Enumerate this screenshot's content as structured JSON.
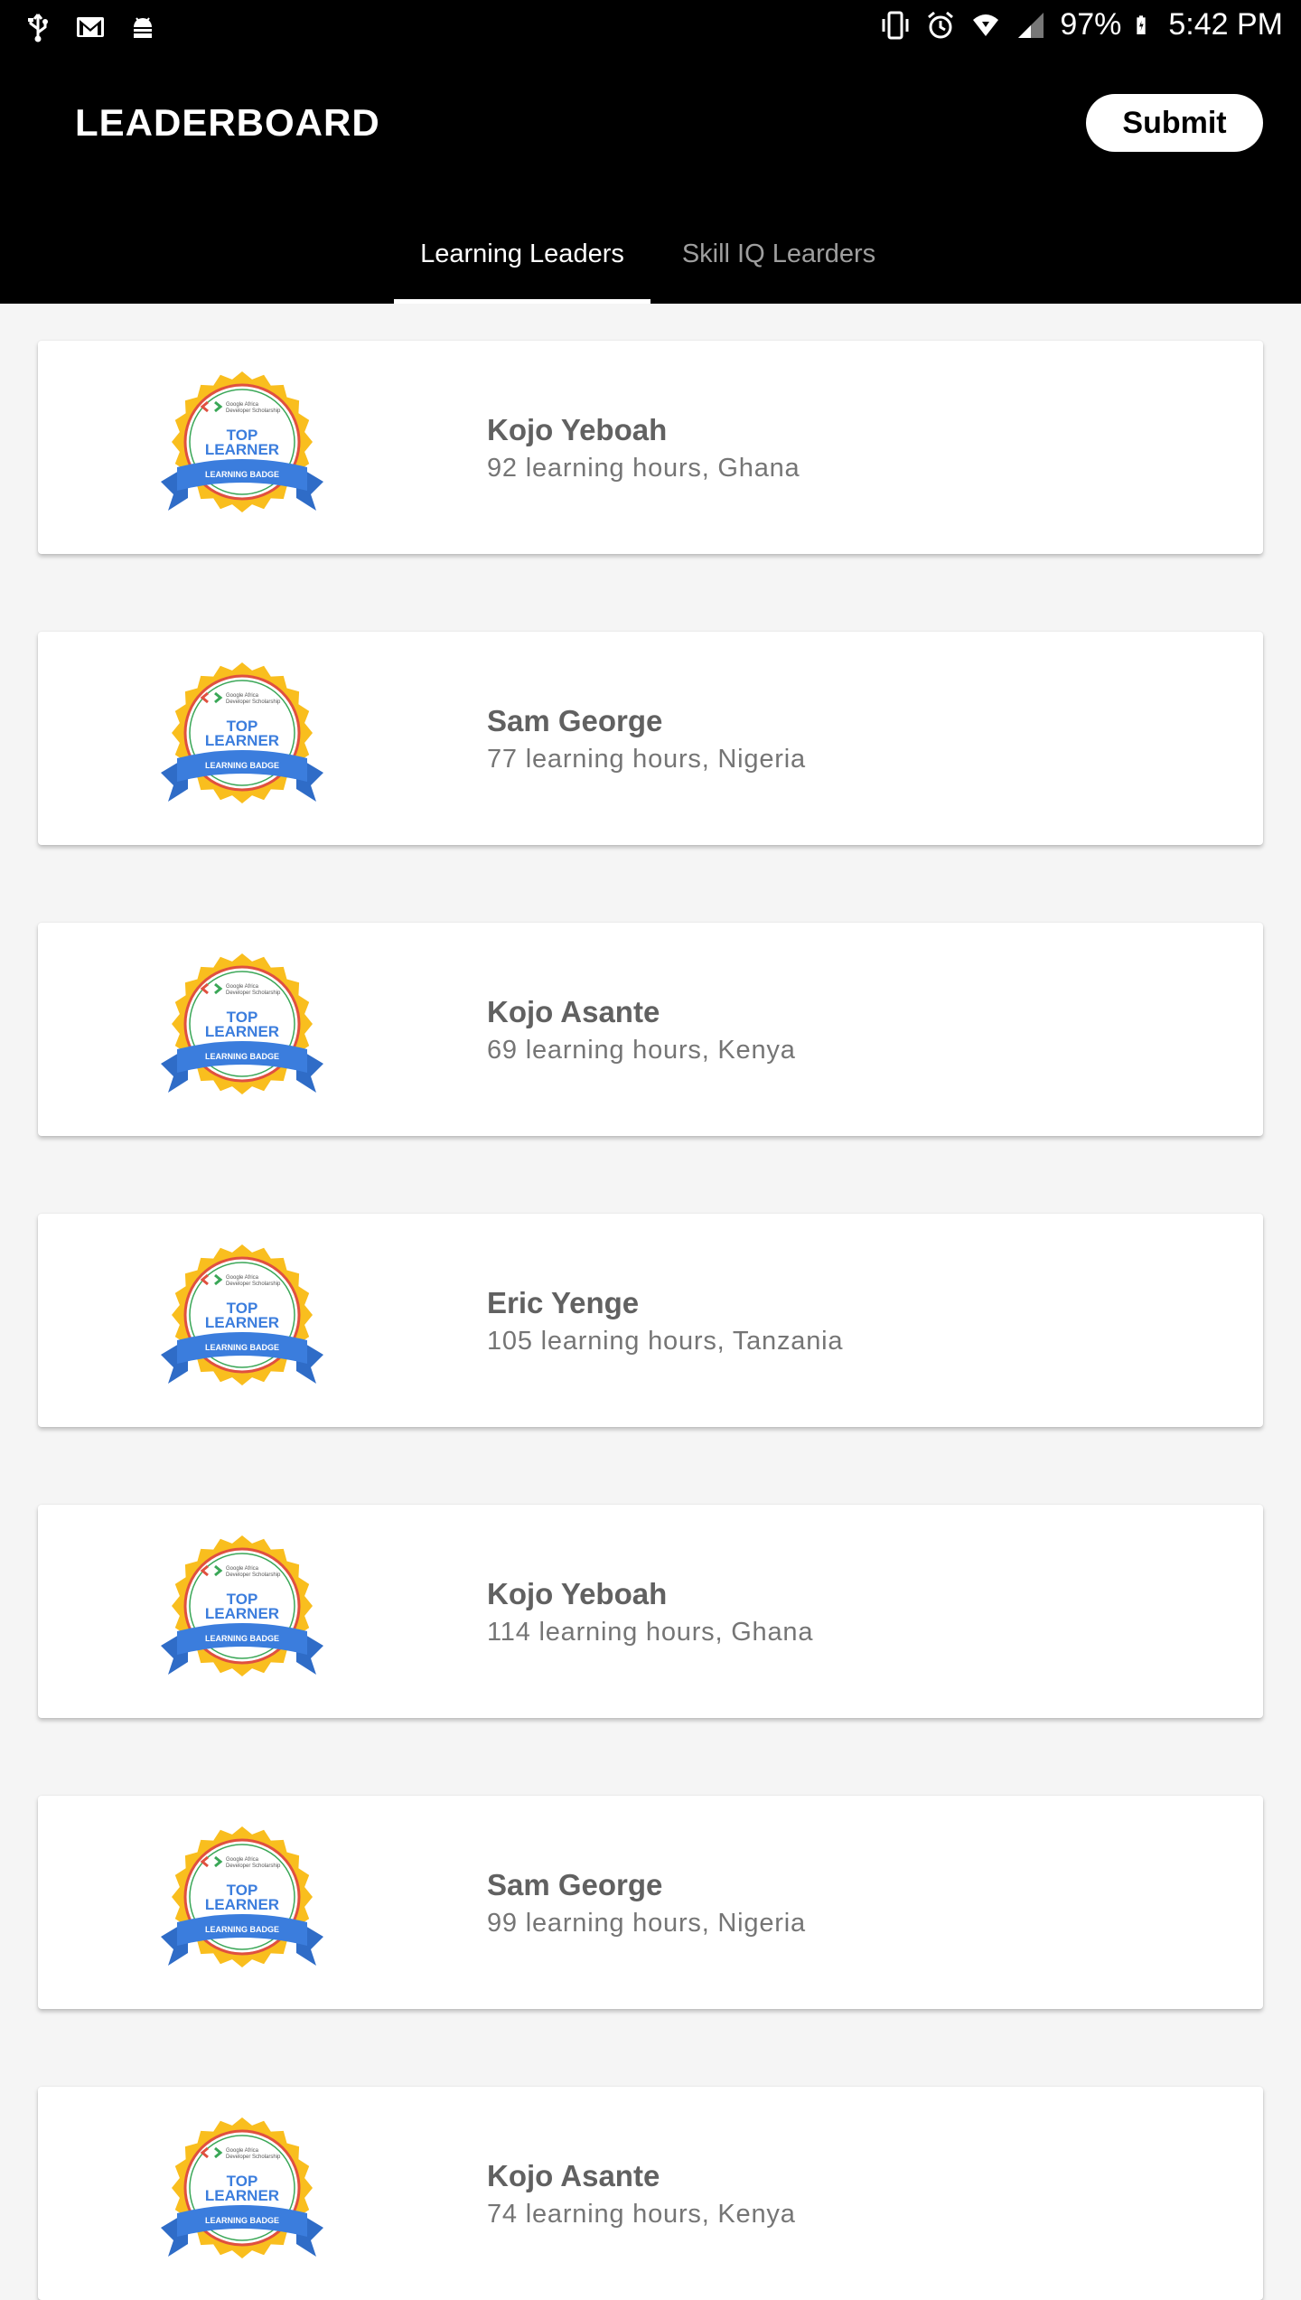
{
  "status_bar": {
    "battery": "97%",
    "time": "5:42 PM",
    "left_icons": [
      "usb-icon",
      "gmail-icon",
      "android-debug-icon"
    ],
    "right_icons": [
      "vibrate-icon",
      "alarm-icon",
      "wifi-icon",
      "signal-icon",
      "battery-icon"
    ]
  },
  "app_bar": {
    "title": "LEADERBOARD",
    "submit_label": "Submit"
  },
  "tabs": [
    {
      "label": "Learning Leaders",
      "active": true
    },
    {
      "label": "Skill IQ Learders",
      "active": false
    }
  ],
  "badge": {
    "top_text": "Google Africa Developer Scholarship",
    "line1": "TOP",
    "line2": "LEARNER",
    "ribbon": "LEARNING BADGE"
  },
  "leaders": [
    {
      "name": "Kojo Yeboah",
      "detail": "92 learning hours, Ghana"
    },
    {
      "name": "Sam George",
      "detail": "77 learning hours, Nigeria"
    },
    {
      "name": "Kojo Asante",
      "detail": "69 learning hours, Kenya"
    },
    {
      "name": "Eric Yenge",
      "detail": "105 learning hours, Tanzania"
    },
    {
      "name": "Kojo Yeboah",
      "detail": "114 learning hours, Ghana"
    },
    {
      "name": "Sam George",
      "detail": "99 learning hours, Nigeria"
    },
    {
      "name": "Kojo Asante",
      "detail": "74 learning hours, Kenya"
    }
  ],
  "colors": {
    "app_bar": "#000000",
    "badge_gold": "#F9BE1E",
    "badge_blue": "#3B7DDD",
    "badge_ring_red": "#E0503F",
    "name_text": "#616161",
    "detail_text": "#757575"
  }
}
